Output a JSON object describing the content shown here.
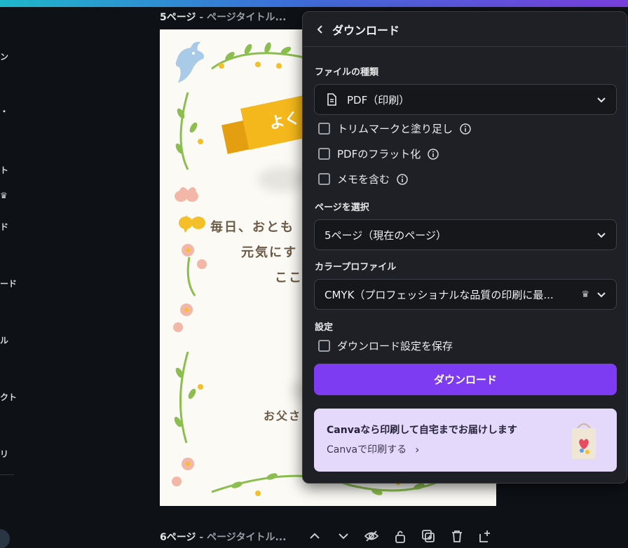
{
  "sidebar": {
    "labels": [
      "ン",
      "・",
      "ト",
      "♛",
      "ド",
      "ード",
      "ル",
      "クト",
      "リ"
    ]
  },
  "pages": {
    "page5_header": {
      "num": "5ページ",
      "sep": " - ",
      "title": "ページタイトル..."
    },
    "page6_header": {
      "num": "6ページ",
      "sep": " - ",
      "title": "ページタイトル..."
    }
  },
  "card": {
    "ribbon_text": "よく",
    "line1": "毎日、おとも",
    "line2": "元気にす",
    "line3": "ここ",
    "line4": "お父さ"
  },
  "panel": {
    "title": "ダウンロード",
    "file_type_label": "ファイルの種類",
    "file_type_value": "PDF（印刷）",
    "options": [
      {
        "label": "トリムマークと塗り足し",
        "checked": false
      },
      {
        "label": "PDFのフラット化",
        "checked": false
      },
      {
        "label": "メモを含む",
        "checked": false
      }
    ],
    "page_select_label": "ページを選択",
    "page_select_value": "5ページ（現在のページ）",
    "color_profile_label": "カラープロファイル",
    "color_profile_value": "CMYK（プロフェッショナルな品質の印刷に最...",
    "settings_label": "設定",
    "save_settings_label": "ダウンロード設定を保存",
    "download_button": "ダウンロード",
    "promo": {
      "title": "Canvaなら印刷して自宅までお届けします",
      "link": "Canvaで印刷する"
    }
  },
  "colors": {
    "accent": "#7d3cf2",
    "promo_bg": "#e5d9fb",
    "panel_bg": "#1e2025",
    "app_bg": "#0e1116"
  },
  "icons": [
    "back-icon",
    "document-icon",
    "chevron-down-icon",
    "info-icon",
    "crown-icon",
    "chevron-right-icon",
    "chevron-up-icon",
    "eye-slash-icon",
    "lock-icon",
    "duplicate-icon",
    "trash-icon",
    "add-page-icon"
  ]
}
